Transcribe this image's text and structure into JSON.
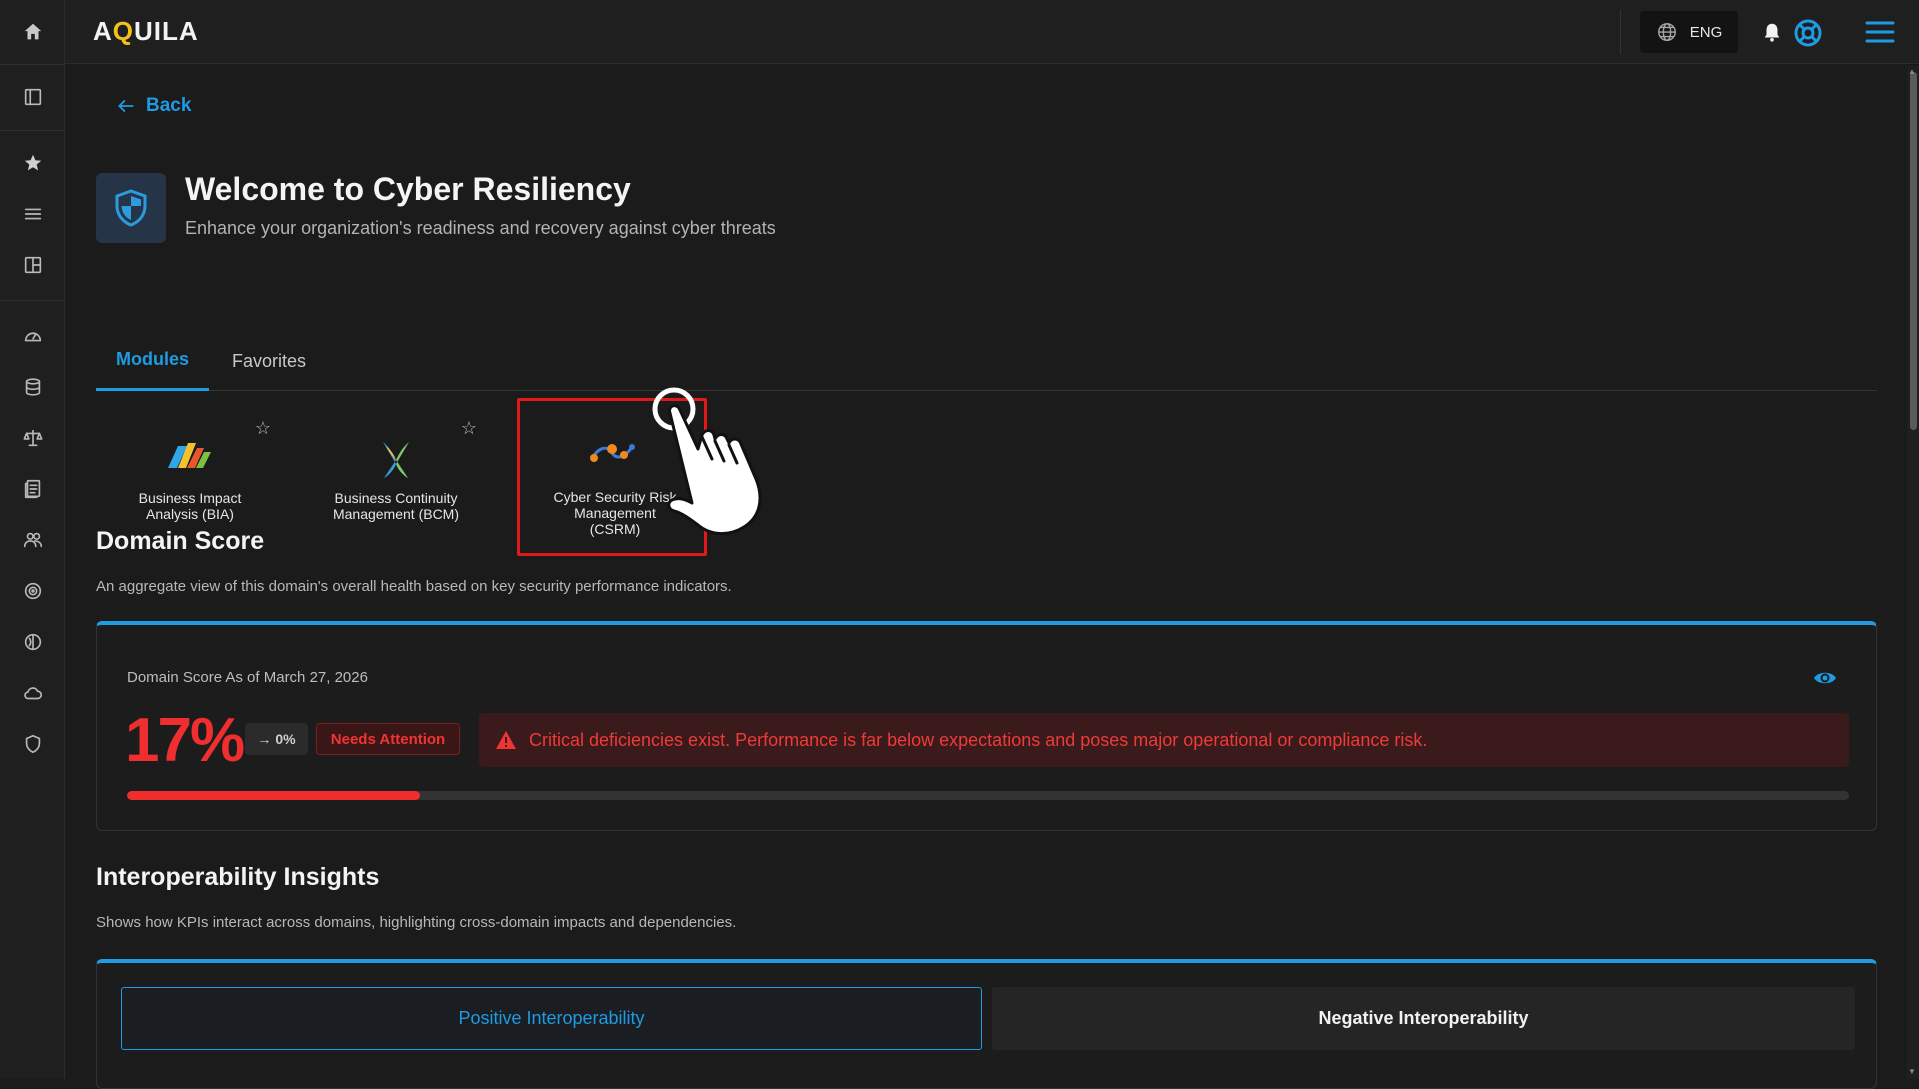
{
  "app": {
    "logo_text_a": "A",
    "logo_text_q": "Q",
    "logo_text_rest": "UILA"
  },
  "topbar": {
    "language": "ENG"
  },
  "back_label": "Back",
  "hero": {
    "title": "Welcome to Cyber Resiliency",
    "subtitle": "Enhance your organization's readiness and recovery against cyber threats"
  },
  "tabs": [
    {
      "label": "Modules",
      "active": true
    },
    {
      "label": "Favorites",
      "active": false
    }
  ],
  "modules": [
    {
      "label_line1": "Business Impact",
      "label_line2": "Analysis (BIA)",
      "label_line3": ""
    },
    {
      "label_line1": "Business Continuity",
      "label_line2": "Management (BCM)",
      "label_line3": ""
    },
    {
      "label_line1": "Cyber Security Risk",
      "label_line2": "Management",
      "label_line3": "(CSRM)"
    }
  ],
  "domain_score": {
    "title": "Domain Score",
    "description": "An aggregate view of this domain's overall health based on key security performance indicators.",
    "date_label": "Domain Score As of March 27, 2026",
    "value": "17%",
    "progress_fraction": 0.17,
    "trend": "0%",
    "status": "Needs Attention",
    "alert": "Critical deficiencies exist. Performance is far below expectations and poses major operational or compliance risk."
  },
  "interoperability": {
    "title": "Interoperability Insights",
    "description": "Shows how KPIs interact across domains, highlighting cross-domain impacts and dependencies.",
    "tabs": [
      {
        "label": "Positive Interoperability",
        "active": true
      },
      {
        "label": "Negative Interoperability",
        "active": false
      }
    ]
  },
  "colors": {
    "accent": "#1e9be2",
    "danger": "#ef2f2f",
    "background": "#1b1b1b"
  }
}
